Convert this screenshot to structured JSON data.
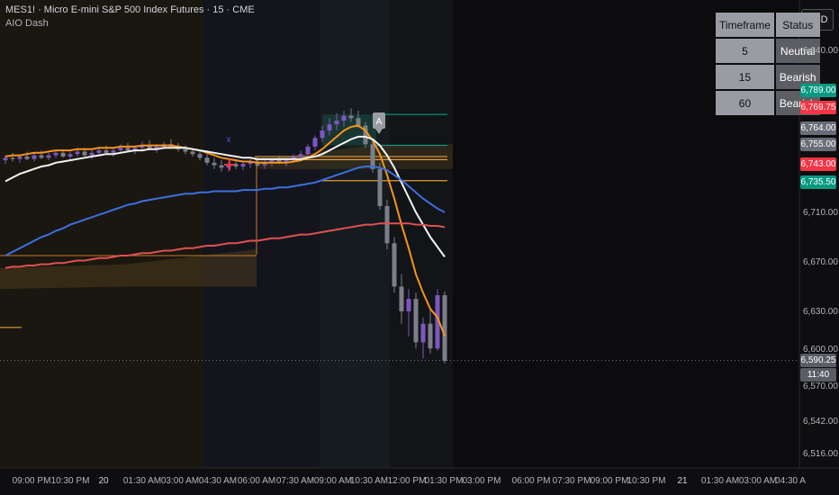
{
  "header": {
    "title": "MES1! · Micro E-mini S&P 500 Index Futures · 15 · CME",
    "indicator": "AIO Dash",
    "currency": "USD"
  },
  "status_table": {
    "headers": [
      "Timeframe",
      "Status"
    ],
    "rows": [
      {
        "timeframe": "5",
        "status": "Neutral"
      },
      {
        "timeframe": "15",
        "status": "Bearish"
      },
      {
        "timeframe": "60",
        "status": "Bearish"
      }
    ]
  },
  "markers": {
    "signal_letter": "A",
    "cross_label": "x"
  },
  "price_axis": {
    "labels": [
      "6,840.00",
      "6,710.00",
      "6,670.00",
      "6,630.00",
      "6,600.00",
      "6,570.00",
      "6,542.00",
      "6,516.00"
    ],
    "tags": [
      {
        "text": "6,789.00",
        "color": "#089981"
      },
      {
        "text": "6,769.75",
        "color": "#f23645"
      },
      {
        "text": "6,764.00",
        "color": "#6a6d78"
      },
      {
        "text": "6,755.00",
        "color": "#6a6d78"
      },
      {
        "text": "6,743.00",
        "color": "#f23645"
      },
      {
        "text": "6,735.50",
        "color": "#089981"
      }
    ],
    "last_price": "6,590.25",
    "countdown": "11:40"
  },
  "time_axis": {
    "labels": [
      "09:00 PM",
      "10:30 PM",
      "20",
      "01:30 AM",
      "03:00 AM",
      "04:30 AM",
      "06:00 AM",
      "07:30 AM",
      "09:00 AM",
      "10:30 AM",
      "12:00 PM",
      "01:30 PM",
      "03:00 PM",
      "06:00 PM",
      "07:30 PM",
      "09:00 PM",
      "10:30 PM",
      "21",
      "01:30 AM",
      "03:00 AM",
      "04:30 A"
    ]
  },
  "chart_data": {
    "type": "line",
    "symbol": "MES1!",
    "timeframe": "15",
    "ylim": [
      6516,
      6860
    ],
    "candles": [
      {
        "o": 6752,
        "h": 6756,
        "l": 6749,
        "c": 6754
      },
      {
        "o": 6754,
        "h": 6758,
        "l": 6751,
        "c": 6753
      },
      {
        "o": 6753,
        "h": 6757,
        "l": 6750,
        "c": 6755
      },
      {
        "o": 6755,
        "h": 6759,
        "l": 6752,
        "c": 6753
      },
      {
        "o": 6753,
        "h": 6758,
        "l": 6751,
        "c": 6756
      },
      {
        "o": 6756,
        "h": 6760,
        "l": 6753,
        "c": 6754
      },
      {
        "o": 6754,
        "h": 6758,
        "l": 6752,
        "c": 6756
      },
      {
        "o": 6756,
        "h": 6760,
        "l": 6754,
        "c": 6758
      },
      {
        "o": 6758,
        "h": 6761,
        "l": 6754,
        "c": 6755
      },
      {
        "o": 6755,
        "h": 6759,
        "l": 6752,
        "c": 6757
      },
      {
        "o": 6757,
        "h": 6762,
        "l": 6755,
        "c": 6759
      },
      {
        "o": 6759,
        "h": 6762,
        "l": 6755,
        "c": 6756
      },
      {
        "o": 6756,
        "h": 6760,
        "l": 6753,
        "c": 6758
      },
      {
        "o": 6758,
        "h": 6763,
        "l": 6756,
        "c": 6760
      },
      {
        "o": 6760,
        "h": 6764,
        "l": 6757,
        "c": 6758
      },
      {
        "o": 6758,
        "h": 6762,
        "l": 6755,
        "c": 6760
      },
      {
        "o": 6760,
        "h": 6765,
        "l": 6758,
        "c": 6762
      },
      {
        "o": 6762,
        "h": 6766,
        "l": 6759,
        "c": 6760
      },
      {
        "o": 6760,
        "h": 6764,
        "l": 6757,
        "c": 6762
      },
      {
        "o": 6762,
        "h": 6767,
        "l": 6760,
        "c": 6764
      },
      {
        "o": 6764,
        "h": 6768,
        "l": 6760,
        "c": 6761
      },
      {
        "o": 6761,
        "h": 6765,
        "l": 6758,
        "c": 6763
      },
      {
        "o": 6763,
        "h": 6767,
        "l": 6761,
        "c": 6765
      },
      {
        "o": 6765,
        "h": 6769,
        "l": 6762,
        "c": 6763
      },
      {
        "o": 6763,
        "h": 6766,
        "l": 6759,
        "c": 6761
      },
      {
        "o": 6761,
        "h": 6764,
        "l": 6757,
        "c": 6759
      },
      {
        "o": 6759,
        "h": 6762,
        "l": 6755,
        "c": 6757
      },
      {
        "o": 6757,
        "h": 6760,
        "l": 6752,
        "c": 6754
      },
      {
        "o": 6754,
        "h": 6757,
        "l": 6748,
        "c": 6750
      },
      {
        "o": 6750,
        "h": 6754,
        "l": 6745,
        "c": 6748
      },
      {
        "o": 6748,
        "h": 6752,
        "l": 6743,
        "c": 6746
      },
      {
        "o": 6746,
        "h": 6751,
        "l": 6743,
        "c": 6749
      },
      {
        "o": 6749,
        "h": 6753,
        "l": 6745,
        "c": 6747
      },
      {
        "o": 6747,
        "h": 6751,
        "l": 6744,
        "c": 6749
      },
      {
        "o": 6749,
        "h": 6753,
        "l": 6746,
        "c": 6751
      },
      {
        "o": 6751,
        "h": 6754,
        "l": 6747,
        "c": 6748
      },
      {
        "o": 6748,
        "h": 6752,
        "l": 6745,
        "c": 6750
      },
      {
        "o": 6750,
        "h": 6754,
        "l": 6747,
        "c": 6752
      },
      {
        "o": 6752,
        "h": 6756,
        "l": 6749,
        "c": 6750
      },
      {
        "o": 6750,
        "h": 6754,
        "l": 6747,
        "c": 6752
      },
      {
        "o": 6752,
        "h": 6757,
        "l": 6750,
        "c": 6755
      },
      {
        "o": 6755,
        "h": 6760,
        "l": 6752,
        "c": 6757
      },
      {
        "o": 6757,
        "h": 6765,
        "l": 6755,
        "c": 6763
      },
      {
        "o": 6763,
        "h": 6772,
        "l": 6760,
        "c": 6770
      },
      {
        "o": 6770,
        "h": 6780,
        "l": 6767,
        "c": 6776
      },
      {
        "o": 6776,
        "h": 6786,
        "l": 6772,
        "c": 6781
      },
      {
        "o": 6781,
        "h": 6790,
        "l": 6776,
        "c": 6784
      },
      {
        "o": 6784,
        "h": 6792,
        "l": 6779,
        "c": 6788
      },
      {
        "o": 6788,
        "h": 6794,
        "l": 6783,
        "c": 6786
      },
      {
        "o": 6786,
        "h": 6792,
        "l": 6778,
        "c": 6780
      },
      {
        "o": 6780,
        "h": 6783,
        "l": 6762,
        "c": 6765
      },
      {
        "o": 6765,
        "h": 6768,
        "l": 6742,
        "c": 6745
      },
      {
        "o": 6745,
        "h": 6750,
        "l": 6712,
        "c": 6715
      },
      {
        "o": 6715,
        "h": 6720,
        "l": 6680,
        "c": 6685
      },
      {
        "o": 6685,
        "h": 6690,
        "l": 6645,
        "c": 6650
      },
      {
        "o": 6650,
        "h": 6660,
        "l": 6620,
        "c": 6630
      },
      {
        "o": 6630,
        "h": 6648,
        "l": 6610,
        "c": 6640
      },
      {
        "o": 6640,
        "h": 6645,
        "l": 6600,
        "c": 6605
      },
      {
        "o": 6605,
        "h": 6625,
        "l": 6592,
        "c": 6620
      },
      {
        "o": 6620,
        "h": 6632,
        "l": 6596,
        "c": 6600
      },
      {
        "o": 6600,
        "h": 6648,
        "l": 6598,
        "c": 6643
      },
      {
        "o": 6643,
        "h": 6646,
        "l": 6588,
        "c": 6590
      }
    ],
    "series": [
      {
        "values": [
          6755,
          6756,
          6756,
          6757,
          6758,
          6758,
          6759,
          6760,
          6760,
          6760,
          6761,
          6761,
          6761,
          6762,
          6762,
          6762,
          6763,
          6763,
          6763,
          6764,
          6764,
          6764,
          6764,
          6764,
          6763,
          6762,
          6761,
          6760,
          6758,
          6756,
          6754,
          6753,
          6752,
          6751,
          6751,
          6750,
          6750,
          6750,
          6750,
          6750,
          6751,
          6752,
          6754,
          6757,
          6761,
          6766,
          6771,
          6776,
          6779,
          6780,
          6776,
          6768,
          6757,
          6740,
          6721,
          6700,
          6681,
          6660,
          6645,
          6632,
          6625,
          6610
        ]
      },
      {
        "values": [
          6735,
          6738,
          6741,
          6743,
          6745,
          6747,
          6748,
          6750,
          6751,
          6752,
          6753,
          6754,
          6755,
          6756,
          6757,
          6757,
          6758,
          6759,
          6760,
          6760,
          6761,
          6761,
          6762,
          6762,
          6762,
          6762,
          6761,
          6760,
          6759,
          6758,
          6757,
          6756,
          6755,
          6754,
          6754,
          6753,
          6753,
          6753,
          6753,
          6753,
          6753,
          6753,
          6754,
          6755,
          6757,
          6760,
          6763,
          6766,
          6769,
          6771,
          6771,
          6769,
          6764,
          6756,
          6746,
          6734,
          6722,
          6710,
          6700,
          6690,
          6682,
          6674
        ]
      },
      {
        "values": [
          6675,
          6678,
          6681,
          6684,
          6687,
          6690,
          6692,
          6695,
          6697,
          6700,
          6702,
          6704,
          6706,
          6708,
          6710,
          6712,
          6714,
          6716,
          6717,
          6719,
          6720,
          6721,
          6722,
          6723,
          6724,
          6725,
          6725,
          6726,
          6726,
          6727,
          6727,
          6727,
          6727,
          6728,
          6728,
          6728,
          6729,
          6729,
          6730,
          6730,
          6731,
          6732,
          6733,
          6734,
          6736,
          6738,
          6740,
          6742,
          6744,
          6746,
          6747,
          6747,
          6746,
          6744,
          6740,
          6736,
          6731,
          6726,
          6721,
          6717,
          6713,
          6710
        ]
      },
      {
        "values": [
          6665,
          6666,
          6666,
          6667,
          6667,
          6668,
          6668,
          6669,
          6669,
          6670,
          6671,
          6671,
          6672,
          6673,
          6673,
          6674,
          6675,
          6675,
          6676,
          6677,
          6677,
          6678,
          6679,
          6679,
          6680,
          6681,
          6681,
          6682,
          6683,
          6683,
          6684,
          6685,
          6685,
          6686,
          6687,
          6687,
          6688,
          6689,
          6689,
          6690,
          6691,
          6692,
          6692,
          6693,
          6694,
          6695,
          6696,
          6697,
          6698,
          6699,
          6700,
          6700,
          6701,
          6701,
          6701,
          6701,
          6701,
          6700,
          6700,
          6699,
          6699,
          6698
        ]
      }
    ],
    "levels": [
      6789.0,
      6769.75,
      6764.0,
      6755.0,
      6743.0,
      6735.5,
      6617
    ],
    "last": 6590.25
  }
}
